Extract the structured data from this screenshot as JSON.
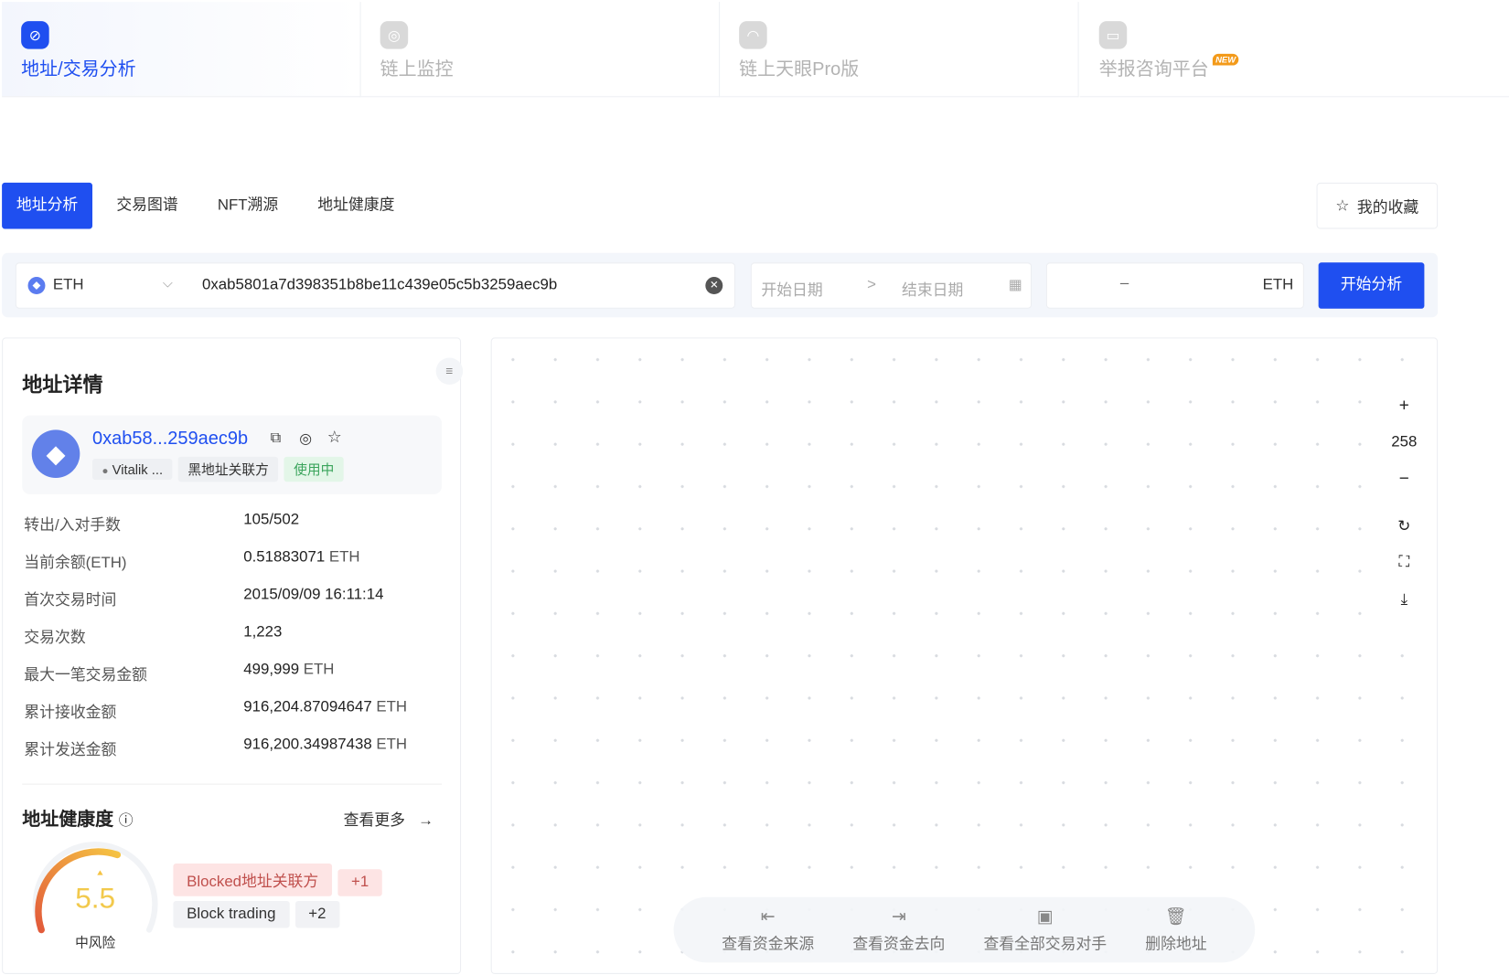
{
  "top_tabs": [
    {
      "label": "地址/交易分析",
      "icon": "chart-swap-icon",
      "active": true
    },
    {
      "label": "链上监控",
      "icon": "webcam-icon"
    },
    {
      "label": "链上天眼Pro版",
      "icon": "radar-icon"
    },
    {
      "label": "举报咨询平台",
      "icon": "report-icon",
      "badge": "NEW"
    }
  ],
  "sub_tabs": [
    "地址分析",
    "交易图谱",
    "NFT溯源",
    "地址健康度"
  ],
  "favorites_label": "我的收藏",
  "search": {
    "chain": "ETH",
    "address": "0xab5801a7d398351b8be11c439e05c5b3259aec9b",
    "start_date_placeholder": "开始日期",
    "date_sep": ">",
    "end_date_placeholder": "结束日期",
    "amount_sep": "–",
    "amount_unit": "ETH",
    "submit": "开始分析"
  },
  "details": {
    "title": "地址详情",
    "short_address": "0xab58...259aec9b",
    "tags": [
      "Vitalik ...",
      "黑地址关联方",
      "使用中"
    ],
    "rows": [
      {
        "label": "转出/入对手数",
        "value": "105/502",
        "unit": ""
      },
      {
        "label": "当前余额(ETH)",
        "value": "0.51883071",
        "unit": "ETH"
      },
      {
        "label": "首次交易时间",
        "value": "2015/09/09 16:11:14",
        "unit": ""
      },
      {
        "label": "交易次数",
        "value": "1,223",
        "unit": ""
      },
      {
        "label": "最大一笔交易金额",
        "value": "499,999",
        "unit": "ETH"
      },
      {
        "label": "累计接收金额",
        "value": "916,204.87094647",
        "unit": "ETH"
      },
      {
        "label": "累计发送金额",
        "value": "916,200.34987438",
        "unit": "ETH"
      }
    ]
  },
  "health": {
    "title": "地址健康度",
    "more": "查看更多",
    "score": "5.5",
    "score_max": 10,
    "risk": "中风险",
    "tags": [
      {
        "label": "Blocked地址关联方",
        "extra": "+1"
      },
      {
        "label": "Block trading",
        "extra": "+2"
      }
    ],
    "colors": {
      "score": "#f2c94c",
      "danger_tag_bg": "#fde4e4",
      "danger_tag_text": "#c0504d"
    }
  },
  "graph": {
    "zoom": "258",
    "actions": [
      "查看资金来源",
      "查看资金去向",
      "查看全部交易对手",
      "删除地址"
    ]
  },
  "colors": {
    "accent": "#1f4ff0"
  }
}
